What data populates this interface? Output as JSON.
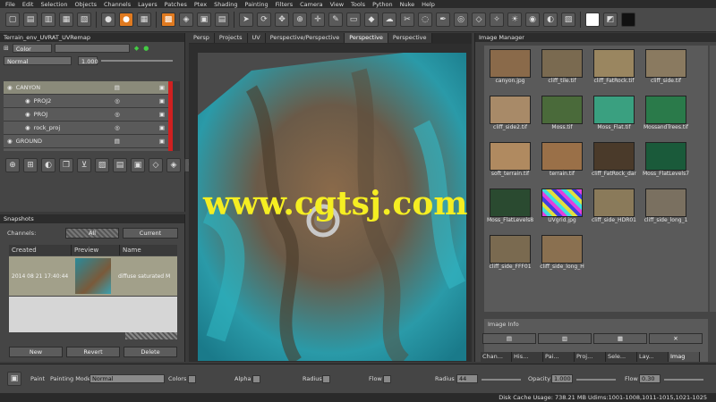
{
  "menu": [
    "File",
    "Edit",
    "Selection",
    "Objects",
    "Channels",
    "Layers",
    "Patches",
    "Ptex",
    "Shading",
    "Painting",
    "Filters",
    "Camera",
    "View",
    "Tools",
    "Python",
    "Nuke",
    "Help"
  ],
  "layers_panel": {
    "title": "Terrain_env_UVRAT_UVRemap",
    "channel_select": "Color",
    "blend_mode": "Normal",
    "opacity": "1.000",
    "layers": [
      {
        "name": "CANYON",
        "indent": 0
      },
      {
        "name": "PROJ2",
        "indent": 1
      },
      {
        "name": "PROJ",
        "indent": 1
      },
      {
        "name": "rock_proj",
        "indent": 1
      },
      {
        "name": "GROUND",
        "indent": 0
      }
    ]
  },
  "snapshots_panel": {
    "title": "Snapshots",
    "channels_label": "Channels:",
    "all_label": "All",
    "current_label": "Current",
    "columns": [
      "Created",
      "Preview",
      "Name"
    ],
    "rows": [
      {
        "created": "2014 08 21 17:40:44",
        "name": "diffuse saturated M"
      }
    ],
    "new_label": "New",
    "revert_label": "Revert",
    "delete_label": "Delete"
  },
  "viewport": {
    "tabs": [
      "Persp",
      "Projects",
      "UV",
      "Perspective/Perspective",
      "Perspective",
      "Perspective"
    ],
    "active_tab": 4,
    "watermark": "www.cgtsj.com"
  },
  "image_manager": {
    "title": "Image Manager",
    "images": [
      {
        "name": "canyon.jpg",
        "color": "#8a6a4a"
      },
      {
        "name": "cliff_tile.tif",
        "color": "#7a6a50"
      },
      {
        "name": "cliff_FatRock.tif",
        "color": "#9a8660"
      },
      {
        "name": "cliff_side.tif",
        "color": "#8a7a60"
      },
      {
        "name": "cliff_side2.tif",
        "color": "#a88a68"
      },
      {
        "name": "Moss.tif",
        "color": "#4a6a3a"
      },
      {
        "name": "Moss_Flat.tif",
        "color": "#3aa080"
      },
      {
        "name": "MossandTrees.tif",
        "color": "#2a7a4a"
      },
      {
        "name": "soft_terrain.tif",
        "color": "#b08a60"
      },
      {
        "name": "terrain.tif",
        "color": "#9a7048"
      },
      {
        "name": "cliff_FatRock_dar",
        "color": "#4a3a2a"
      },
      {
        "name": "Moss_FlatLevels7",
        "color": "#1a5a3a"
      },
      {
        "name": "Moss_FlatLevels8",
        "color": "#2a4a30"
      },
      {
        "name": "UVgrid.jpg",
        "color": "#c070c0"
      },
      {
        "name": "cliff_side_HDR01",
        "color": "#8a7a5a"
      },
      {
        "name": "cliff_side_long_1",
        "color": "#7a7060"
      },
      {
        "name": "cliff_side_FFF01",
        "color": "#7a6a50"
      },
      {
        "name": "cliff_side_long_H",
        "color": "#8a7050"
      }
    ],
    "image_info_label": "Image Info",
    "bottom_tabs": [
      "Chan...",
      "His...",
      "Pai...",
      "Proj...",
      "Sele...",
      "Lay...",
      "Imag"
    ]
  },
  "bottom_bar": {
    "paint_label": "Paint",
    "painting_mode_label": "Painting Mode",
    "painting_mode_value": "Normal",
    "colors_label": "Colors",
    "alpha_label": "Alpha",
    "radius_label": "Radius",
    "flow_label": "Flow",
    "radius_label2": "Radius",
    "radius_value": "44",
    "opacity_label": "Opacity",
    "opacity_value": "1.000",
    "flow_label2": "Flow",
    "flow_value": "0.30"
  },
  "status": "Disk Cache Usage: 738.21 MB  Udims:1001-1008,1011-1015,1021-1025"
}
